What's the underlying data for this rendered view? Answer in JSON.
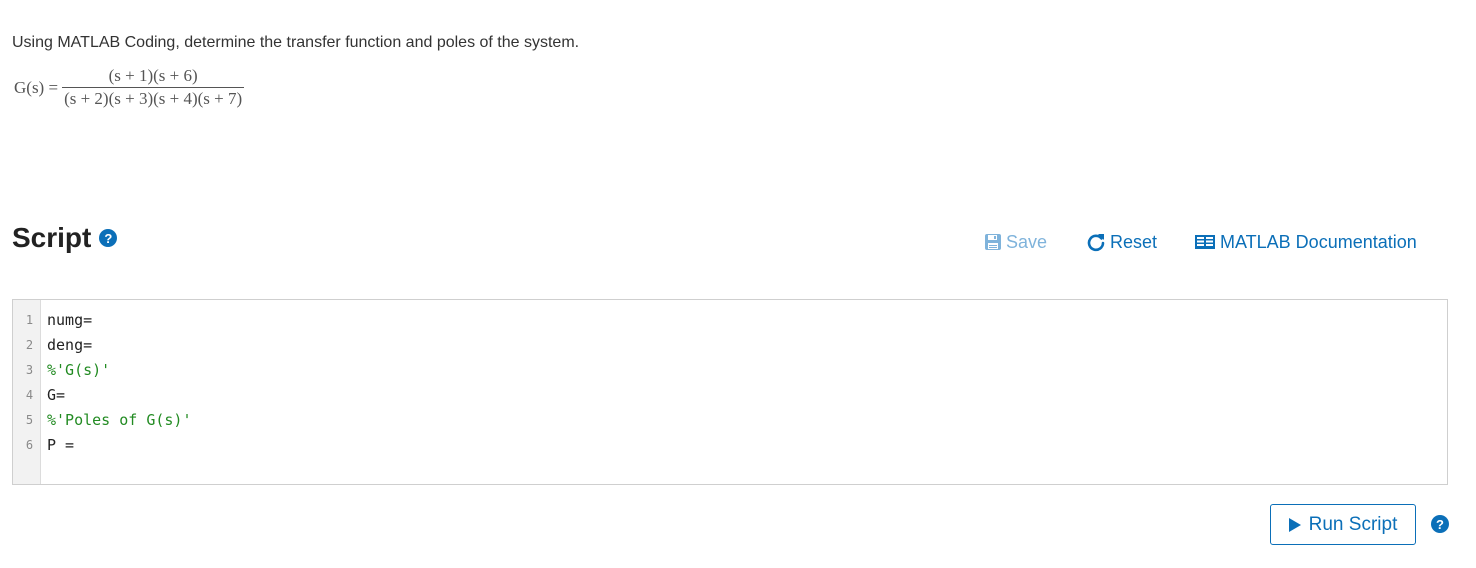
{
  "problem": {
    "text": "Using MATLAB Coding, determine the transfer function and poles of the system.",
    "lhs": "G(s) =",
    "numerator": "(s + 1)(s + 6)",
    "denominator": "(s + 2)(s + 3)(s + 4)(s + 7)"
  },
  "script": {
    "title": "Script",
    "help_icon": "?"
  },
  "toolbar": {
    "save_label": "Save",
    "reset_label": "Reset",
    "doc_label": "MATLAB Documentation"
  },
  "editor": {
    "lines": [
      {
        "num": "1",
        "text": "numg="
      },
      {
        "num": "2",
        "text": "deng="
      },
      {
        "num": "3",
        "text": "%'G(s)'"
      },
      {
        "num": "4",
        "text": "G="
      },
      {
        "num": "5",
        "text": "%'Poles of G(s)'"
      },
      {
        "num": "6",
        "text": "P ="
      }
    ]
  },
  "actions": {
    "run_label": "Run Script",
    "help_icon": "?"
  },
  "colors": {
    "accent": "#0b6fb8",
    "disabled": "#7fb3db",
    "comment": "#228b22"
  },
  "icons": {
    "save": "floppy-disk-icon",
    "reset": "refresh-icon",
    "documentation": "book-icon",
    "run": "play-icon",
    "help": "question-circle-icon"
  }
}
